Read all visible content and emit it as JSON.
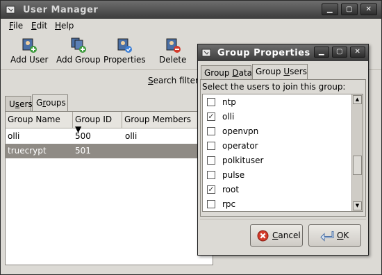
{
  "main": {
    "title": "User Manager",
    "menu": [
      {
        "label": "File",
        "key": "F",
        "rest": "ile"
      },
      {
        "label": "Edit",
        "key": "E",
        "rest": "dit"
      },
      {
        "label": "Help",
        "key": "H",
        "rest": "elp"
      }
    ],
    "toolbar": {
      "add_user": "Add User",
      "add_group": "Add Group",
      "properties": "Properties",
      "delete": "Delete"
    },
    "search": {
      "key": "S",
      "rest": "earch filter:"
    },
    "tabs": {
      "users_key": "s",
      "users_pre": "U",
      "users_post": "ers",
      "groups_key": "r",
      "groups_pre": "G",
      "groups_post": "oups"
    },
    "table": {
      "headers": [
        "Group Name",
        "Group ID",
        "Group Members"
      ],
      "sort_indicator": "▼",
      "rows": [
        {
          "name": "olli",
          "id": "500",
          "members": "olli"
        },
        {
          "name": "truecrypt",
          "id": "501",
          "members": ""
        }
      ]
    }
  },
  "dialog": {
    "title": "Group Properties",
    "tabs": {
      "data_pre": "Group ",
      "data_key": "D",
      "data_post": "ata",
      "users_pre": "Group ",
      "users_key": "U",
      "users_post": "sers"
    },
    "prompt": "Select the users to join this group:",
    "users": [
      {
        "name": "ntp",
        "checked": false
      },
      {
        "name": "olli",
        "checked": true
      },
      {
        "name": "openvpn",
        "checked": false
      },
      {
        "name": "operator",
        "checked": false
      },
      {
        "name": "polkituser",
        "checked": false
      },
      {
        "name": "pulse",
        "checked": false
      },
      {
        "name": "root",
        "checked": true
      },
      {
        "name": "rpc",
        "checked": false
      }
    ],
    "cancel": {
      "key": "C",
      "rest": "ancel"
    },
    "ok": {
      "key": "O",
      "rest": "K"
    }
  },
  "colors": {
    "selection": "#8f8b85",
    "titlebar": "#3c3c3c",
    "window": "#dcdad5"
  },
  "icons": [
    "app-icon",
    "add-user-icon",
    "add-group-icon",
    "properties-icon",
    "delete-icon",
    "cancel-icon",
    "ok-icon"
  ]
}
